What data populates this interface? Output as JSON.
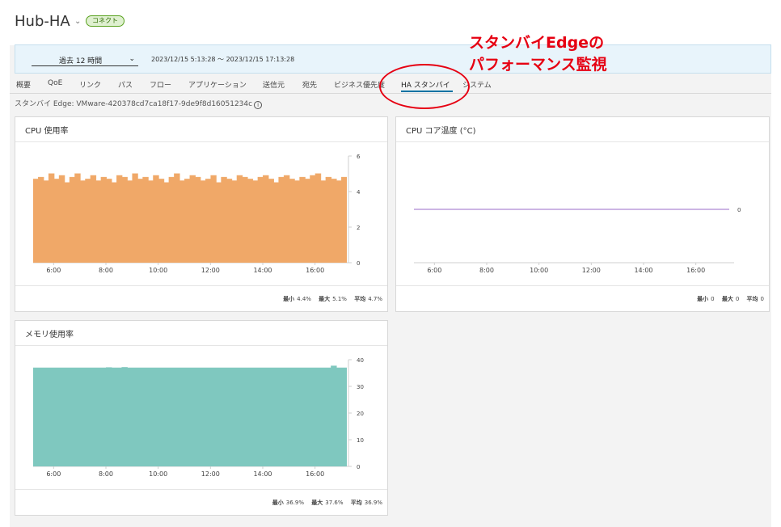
{
  "header": {
    "title": "Hub-HA",
    "status_badge": "コネクト"
  },
  "timebar": {
    "range_label": "過去 12 時間",
    "range_text": "2023/12/15 5:13:28 ～ 2023/12/15 17:13:28"
  },
  "tabs": [
    {
      "label": "概要"
    },
    {
      "label": "QoE"
    },
    {
      "label": "リンク"
    },
    {
      "label": "パス"
    },
    {
      "label": "フロー"
    },
    {
      "label": "アプリケーション"
    },
    {
      "label": "送信元"
    },
    {
      "label": "宛先"
    },
    {
      "label": "ビジネス優先度"
    },
    {
      "label": "HA スタンバイ"
    },
    {
      "label": "システム"
    }
  ],
  "edge_info": "スタンバイ Edge: VMware-420378cd7ca18f17-9de9f8d16051234c",
  "annotation": {
    "line1": "スタンバイEdgeの",
    "line2": "パフォーマンス監視",
    "color": "#e60012"
  },
  "stat_labels": {
    "min": "最小",
    "max": "最大",
    "avg": "平均"
  },
  "cards": {
    "cpu": {
      "title": "CPU 使用率",
      "min": "4.4%",
      "max": "5.1%",
      "avg": "4.7%"
    },
    "temp": {
      "title": "CPU コア温度 (°C)",
      "min": "0",
      "max": "0",
      "avg": "0"
    },
    "mem": {
      "title": "メモリ使用率",
      "min": "36.9%",
      "max": "37.6%",
      "avg": "36.9%"
    }
  },
  "chart_data": [
    {
      "type": "area",
      "title": "CPU 使用率",
      "x_ticks": [
        "6:00",
        "8:00",
        "10:00",
        "12:00",
        "14:00",
        "16:00"
      ],
      "y_ticks": [
        0,
        2,
        4,
        6
      ],
      "ylim": [
        0,
        6
      ],
      "xlim": [
        "5:13",
        "17:13"
      ],
      "series": [
        {
          "values": [
            4.7,
            4.8,
            4.6,
            5.0,
            4.7,
            4.9,
            4.5,
            4.8,
            5.0,
            4.6,
            4.7,
            4.9,
            4.6,
            4.8,
            4.7,
            4.5,
            4.9,
            4.8,
            4.6,
            5.0,
            4.7,
            4.8,
            4.6,
            4.9,
            4.7,
            4.5,
            4.8,
            5.0,
            4.6,
            4.7,
            4.9,
            4.8,
            4.6,
            4.7,
            4.9,
            4.5,
            4.8,
            4.7,
            4.6,
            4.9,
            4.8,
            4.7,
            4.6,
            4.8,
            4.9,
            4.7,
            4.5,
            4.8,
            4.9,
            4.7,
            4.6,
            4.8,
            4.7,
            4.9,
            5.0,
            4.6,
            4.8,
            4.7,
            4.6,
            4.8
          ]
        }
      ],
      "color": "#f0a868"
    },
    {
      "type": "line",
      "title": "CPU コア温度 (°C)",
      "x_ticks": [
        "6:00",
        "8:00",
        "10:00",
        "12:00",
        "14:00",
        "16:00"
      ],
      "y_ticks": [
        0
      ],
      "series": [
        {
          "values": [
            0,
            0
          ]
        }
      ],
      "color": "#9a6bc8"
    },
    {
      "type": "area",
      "title": "メモリ使用率",
      "x_ticks": [
        "6:00",
        "8:00",
        "10:00",
        "12:00",
        "14:00",
        "16:00"
      ],
      "y_ticks": [
        0,
        10,
        20,
        30,
        40
      ],
      "ylim": [
        0,
        40
      ],
      "xlim": [
        "5:13",
        "17:13"
      ],
      "series": [
        {
          "values": [
            36.9,
            36.9,
            36.9,
            36.9,
            36.9,
            36.9,
            36.9,
            36.9,
            36.9,
            36.9,
            36.9,
            36.9,
            36.9,
            36.9,
            37.0,
            36.9,
            36.9,
            37.1,
            36.9,
            36.9,
            36.9,
            36.9,
            36.9,
            36.9,
            36.9,
            36.9,
            36.9,
            36.9,
            36.9,
            36.9,
            36.9,
            36.9,
            36.9,
            36.9,
            36.9,
            36.9,
            36.9,
            36.9,
            36.9,
            36.9,
            36.9,
            36.9,
            36.9,
            36.9,
            36.9,
            36.9,
            36.9,
            36.9,
            36.9,
            36.9,
            36.9,
            36.9,
            36.9,
            36.9,
            36.9,
            36.9,
            36.9,
            37.6,
            36.9,
            36.9
          ]
        }
      ],
      "color": "#7fc8bf"
    }
  ]
}
